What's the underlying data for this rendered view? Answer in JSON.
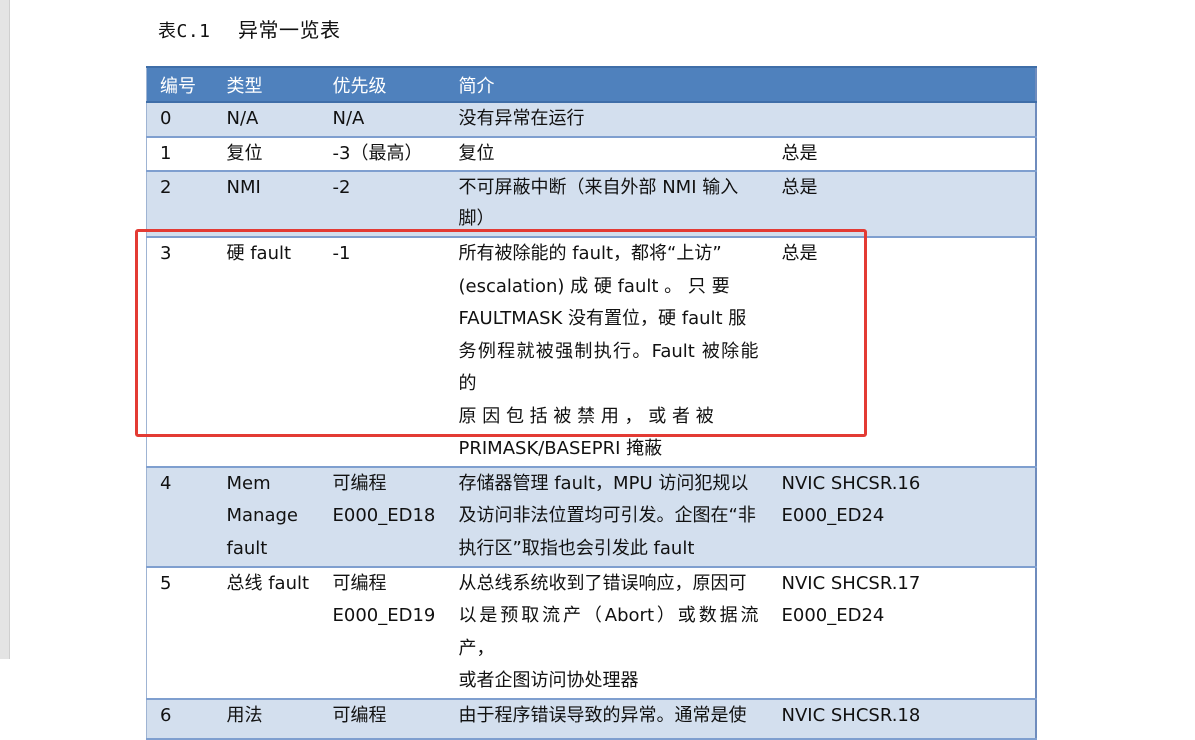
{
  "caption": {
    "label": "表C.1",
    "title": "异常一览表"
  },
  "table": {
    "headers": [
      "编号",
      "类型",
      "优先级",
      "简介",
      ""
    ],
    "rows": [
      {
        "num": "0",
        "type": [
          "N/A"
        ],
        "priority": [
          "N/A"
        ],
        "desc": [
          "没有异常在运行"
        ],
        "extra": [
          ""
        ]
      },
      {
        "num": "1",
        "type": [
          "复位"
        ],
        "priority": [
          "-3（最高）"
        ],
        "desc": [
          "复位"
        ],
        "extra": [
          "总是"
        ]
      },
      {
        "num": "2",
        "type": [
          "NMI"
        ],
        "priority": [
          "-2"
        ],
        "desc": [
          "不可屏蔽中断（来自外部 NMI 输入",
          "脚）"
        ],
        "extra": [
          "总是"
        ]
      },
      {
        "num": "3",
        "type": [
          "硬 fault"
        ],
        "priority": [
          "-1"
        ],
        "desc": [
          "所有被除能的 fault，都将“上访”",
          "(escalation) 成 硬  fault 。 只 要",
          "FAULTMASK 没有置位，硬 fault 服",
          "务例程就被强制执行。Fault 被除能的",
          "原 因 包 括 被 禁 用 ， 或 者 被",
          "PRIMASK/BASEPRI 掩蔽"
        ],
        "extra": [
          "总是"
        ]
      },
      {
        "num": "4",
        "type": [
          "Mem",
          "Manage",
          "fault"
        ],
        "priority": [
          "可编程",
          "E000_ED18"
        ],
        "desc": [
          "存储器管理 fault，MPU 访问犯规以",
          "及访问非法位置均可引发。企图在“非",
          "执行区”取指也会引发此 fault"
        ],
        "extra": [
          "NVIC SHCSR.16",
          "E000_ED24"
        ]
      },
      {
        "num": "5",
        "type": [
          "总线 fault"
        ],
        "priority": [
          "可编程",
          "E000_ED19"
        ],
        "desc": [
          "从总线系统收到了错误响应，原因可",
          "以是预取流产（Abort）或数据流产，",
          "或者企图访问协处理器"
        ],
        "extra": [
          "NVIC SHCSR.17",
          "E000_ED24"
        ]
      },
      {
        "num": "6",
        "type": [
          "用法"
        ],
        "priority": [
          "可编程"
        ],
        "desc": [
          "由于程序错误导致的异常。通常是使"
        ],
        "extra": [
          "NVIC SHCSR.18"
        ]
      }
    ]
  },
  "colors": {
    "header_bg": "#4f81bd",
    "alt_row_bg": "#d3dfee",
    "highlight": "#e33b34"
  }
}
